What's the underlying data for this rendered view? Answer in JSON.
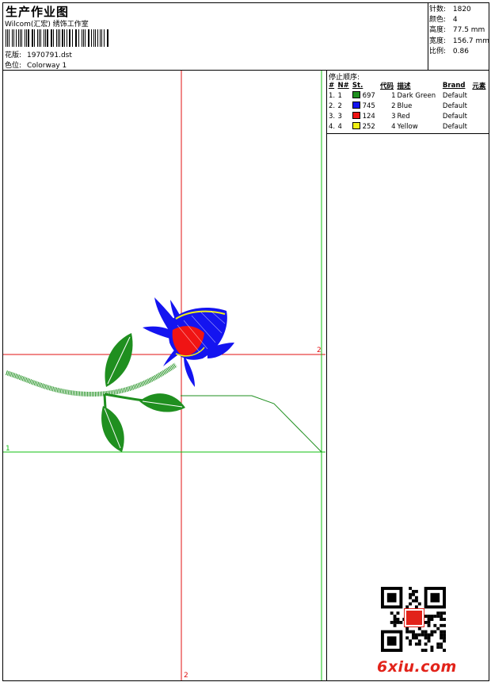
{
  "header": {
    "title": "生产作业图",
    "company": "Wilcom(汇宏) 绣饰工作室",
    "file_label": "花版:",
    "file_name": "1970791.dst",
    "colorway_label": "色位:",
    "colorway_value": "Colorway 1"
  },
  "stats": {
    "stitches_label": "针数:",
    "stitches": "1820",
    "colors_label": "颜色:",
    "colors": "4",
    "height_label": "高度:",
    "height": "77.5 mm",
    "width_label": "宽度:",
    "width": "156.7 mm",
    "scale_label": "比例:",
    "scale": "0.86"
  },
  "stop_sequence": {
    "title": "停止顺序:",
    "columns": [
      "#",
      "N#",
      "St.",
      "代码",
      "描述",
      "Brand",
      "元素"
    ],
    "rows": [
      {
        "idx": "1.",
        "n": "1",
        "color": "#1f8f1f",
        "stitches": "697",
        "code": "1",
        "desc": "Dark Green",
        "brand": "Default"
      },
      {
        "idx": "2.",
        "n": "2",
        "color": "#1414f0",
        "stitches": "745",
        "code": "2",
        "desc": "Blue",
        "brand": "Default"
      },
      {
        "idx": "3.",
        "n": "3",
        "color": "#f01414",
        "stitches": "124",
        "code": "3",
        "desc": "Red",
        "brand": "Default"
      },
      {
        "idx": "4.",
        "n": "4",
        "color": "#f0f014",
        "stitches": "252",
        "code": "4",
        "desc": "Yellow",
        "brand": "Default"
      }
    ]
  },
  "canvas": {
    "marker_1_left": "1",
    "marker_2_right": "2",
    "marker_2_bottom": "2",
    "axis_red": "#e01010",
    "axis_green": "#10c010"
  },
  "watermark": {
    "site": "6xiu.com",
    "qr_icon": "qr-code-icon",
    "seal_icon": "red-seal-icon"
  }
}
